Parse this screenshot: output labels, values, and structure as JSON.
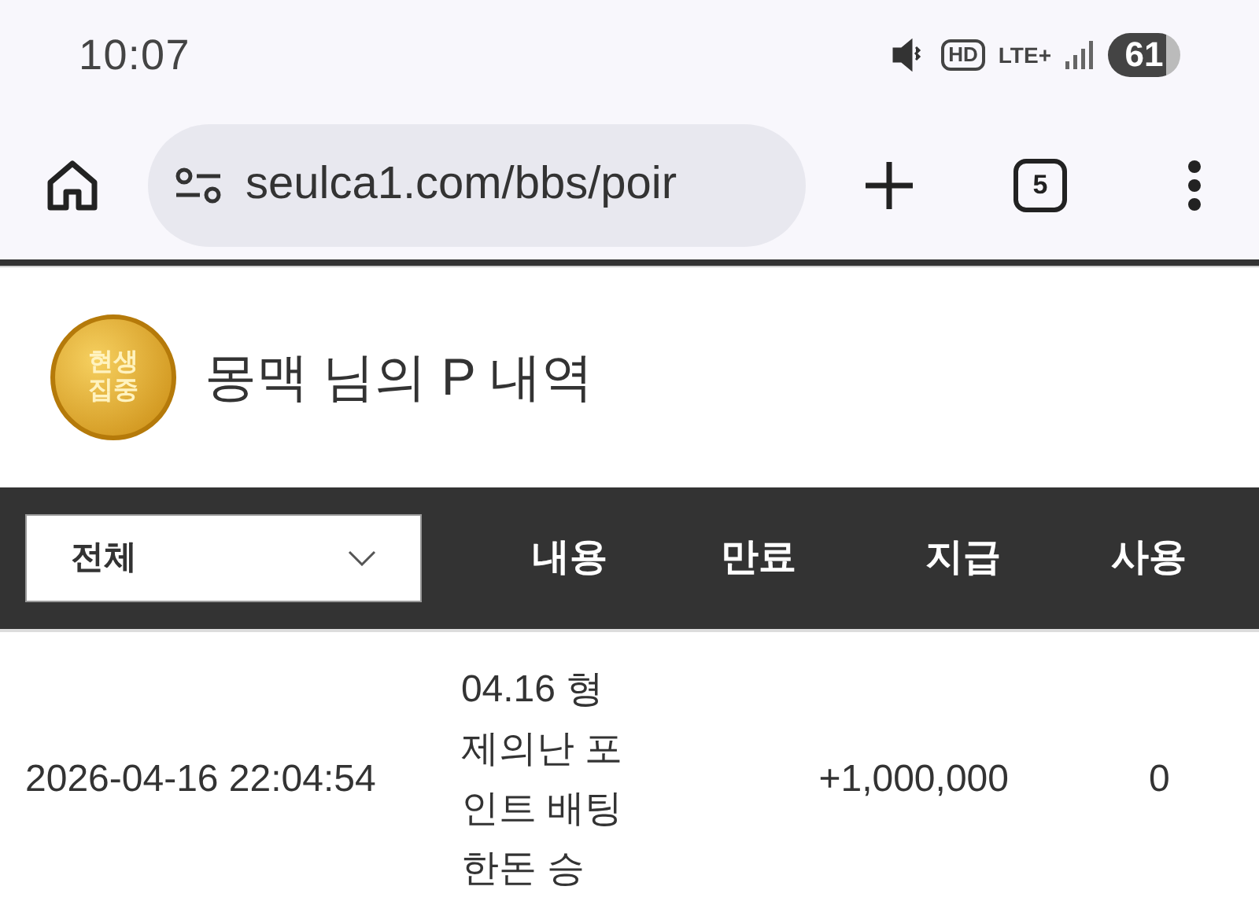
{
  "status_bar": {
    "time": "10:07",
    "hd": "HD",
    "network": "LTE+",
    "battery": "61"
  },
  "browser": {
    "url": "seulca1.com/bbs/poir",
    "tab_count": "5"
  },
  "page": {
    "logo_text": [
      "현생",
      "집중"
    ],
    "title": "몽맥 님의 P 내역"
  },
  "table": {
    "filter": {
      "value": "전체"
    },
    "columns": [
      "내용",
      "만료",
      "지급",
      "사용"
    ],
    "rows": [
      {
        "date": "2026-04-16 22:04:54",
        "content": [
          "04.16 형",
          "제의난 포",
          "인트 배팅",
          "한돈 승"
        ],
        "paid": "+1,000,000",
        "used": "0"
      }
    ]
  }
}
